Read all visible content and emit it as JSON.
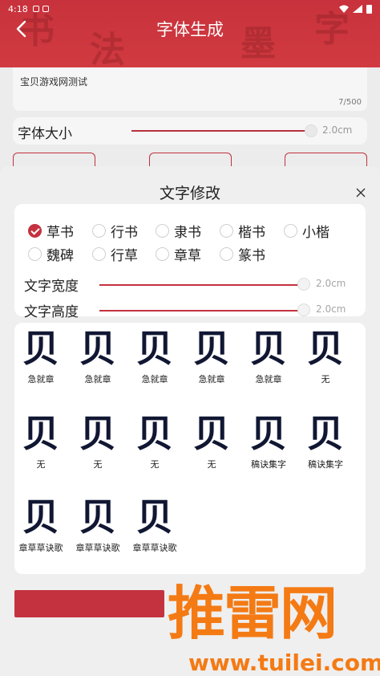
{
  "status_bar": {
    "time": "4:18"
  },
  "header": {
    "title": "字体生成"
  },
  "input": {
    "value": "宝贝游戏网测试",
    "counter": "7/500"
  },
  "font_size": {
    "label": "字体大小",
    "value": "2.0cm"
  },
  "dialog": {
    "title": "文字修改",
    "styles": [
      {
        "label": "草书",
        "selected": true
      },
      {
        "label": "行书",
        "selected": false
      },
      {
        "label": "隶书",
        "selected": false
      },
      {
        "label": "楷书",
        "selected": false
      },
      {
        "label": "小楷",
        "selected": false
      },
      {
        "label": "魏碑",
        "selected": false
      },
      {
        "label": "行草",
        "selected": false
      },
      {
        "label": "章草",
        "selected": false
      },
      {
        "label": "篆书",
        "selected": false
      }
    ],
    "width_slider": {
      "label": "文字宽度",
      "value": "2.0cm"
    },
    "height_slider": {
      "label": "文字高度",
      "value": "2.0cm"
    },
    "glyphs": [
      {
        "char": "贝",
        "source": "急就章"
      },
      {
        "char": "贝",
        "source": "急就章"
      },
      {
        "char": "贝",
        "source": "急就章"
      },
      {
        "char": "贝",
        "source": "急就章"
      },
      {
        "char": "贝",
        "source": "急就章"
      },
      {
        "char": "贝",
        "source": "无"
      },
      {
        "char": "贝",
        "source": "无"
      },
      {
        "char": "贝",
        "source": "无"
      },
      {
        "char": "贝",
        "source": "无"
      },
      {
        "char": "贝",
        "source": "无"
      },
      {
        "char": "贝",
        "source": "稿诀集字"
      },
      {
        "char": "贝",
        "source": "稿诀集字"
      },
      {
        "char": "贝",
        "source": "章草草诀歌"
      },
      {
        "char": "贝",
        "source": "章草草诀歌"
      },
      {
        "char": "贝",
        "source": "章草草诀歌"
      }
    ]
  },
  "watermark": {
    "brand": "推雷网",
    "url": "www.tuilei.com"
  },
  "colors": {
    "accent": "#c4323f",
    "header": "#cc3640",
    "watermark": "#f47a14"
  }
}
